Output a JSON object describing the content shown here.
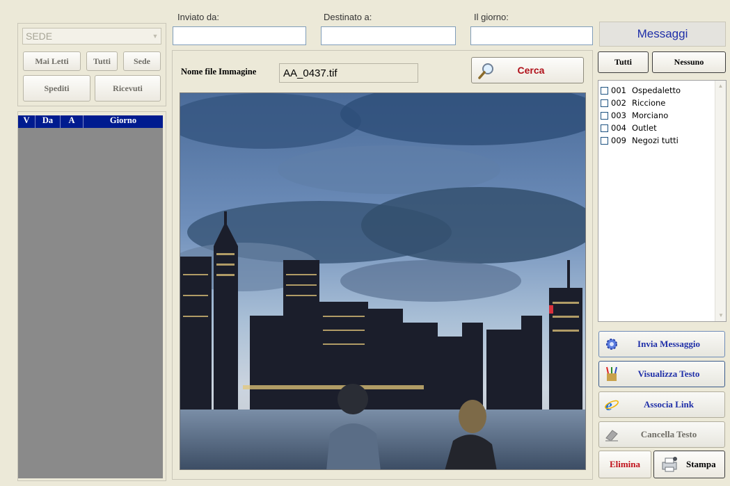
{
  "left_panel": {
    "sede_select": "SEDE",
    "filter_buttons": [
      "Mai Letti",
      "Tutti",
      "Sede"
    ],
    "direction_buttons": [
      "Spediti",
      "Ricevuti"
    ],
    "table_headers": [
      "V",
      "Da",
      "A",
      "Giorno"
    ]
  },
  "search": {
    "inviato_da_label": "Inviato da:",
    "destinato_a_label": "Destinato a:",
    "il_giorno_label": "Il giorno:"
  },
  "image_panel": {
    "filename_label": "Nome file Immagine",
    "filename_value": "AA_0437.tif",
    "cerca_label": "Cerca"
  },
  "right_panel": {
    "title": "Messaggi",
    "tutti_label": "Tutti",
    "nessuno_label": "Nessuno",
    "recipients": [
      {
        "code": "001",
        "name": "Ospedaletto"
      },
      {
        "code": "002",
        "name": "Riccione"
      },
      {
        "code": "003",
        "name": "Morciano"
      },
      {
        "code": "004",
        "name": "Outlet"
      },
      {
        "code": "009",
        "name": "Negozi tutti"
      }
    ],
    "actions": {
      "invia": "Invia Messaggio",
      "visualizza": "Visualizza Testo",
      "associa": "Associa Link",
      "cancella": "Cancella Testo",
      "elimina": "Elimina",
      "stampa": "Stampa"
    }
  },
  "colors": {
    "accent_blue": "#1f2fa8",
    "table_header": "#001b8f",
    "elimina_red": "#c0101a",
    "cerca_red": "#b0101a"
  }
}
